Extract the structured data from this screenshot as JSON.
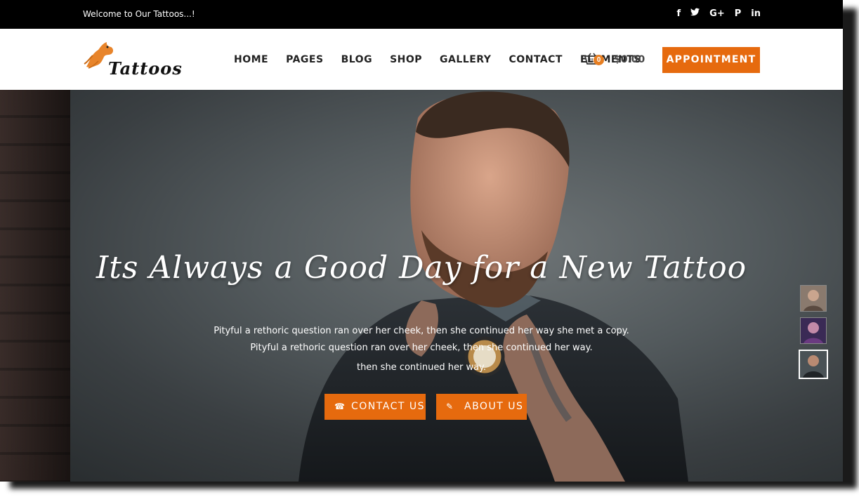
{
  "topbar": {
    "welcome": "Welcome to Our Tattoos...!",
    "social": [
      {
        "icon": "facebook-icon",
        "glyph": "f"
      },
      {
        "icon": "twitter-icon",
        "glyph": "🐦"
      },
      {
        "icon": "google-plus-icon",
        "glyph": "G+"
      },
      {
        "icon": "pinterest-icon",
        "glyph": "P"
      },
      {
        "icon": "linkedin-icon",
        "glyph": "in"
      }
    ]
  },
  "header": {
    "logo_text": "Tattoos",
    "menu": [
      "HOME",
      "PAGES",
      "BLOG",
      "SHOP",
      "GALLERY",
      "CONTACT",
      "ELEMENTS"
    ],
    "cart_count": "0",
    "cart_total": "$0.00",
    "appointment_label": "APPOINTMENT"
  },
  "hero": {
    "title": "Its Always a Good Day for a New Tattoo",
    "lines": [
      "Pityful a rethoric question ran over her cheek, then she continued her way she met a copy.",
      "Pityful a rethoric question ran over her cheek, then she continued her way.",
      "then she continued her way."
    ],
    "contact_label": "CONTACT US",
    "contact_icon": "phone-icon",
    "about_label": "ABOUT US",
    "about_icon": "edit-icon"
  },
  "colors": {
    "accent": "#e66a0e",
    "topbar_bg": "#000000",
    "text_dark": "#222222"
  }
}
